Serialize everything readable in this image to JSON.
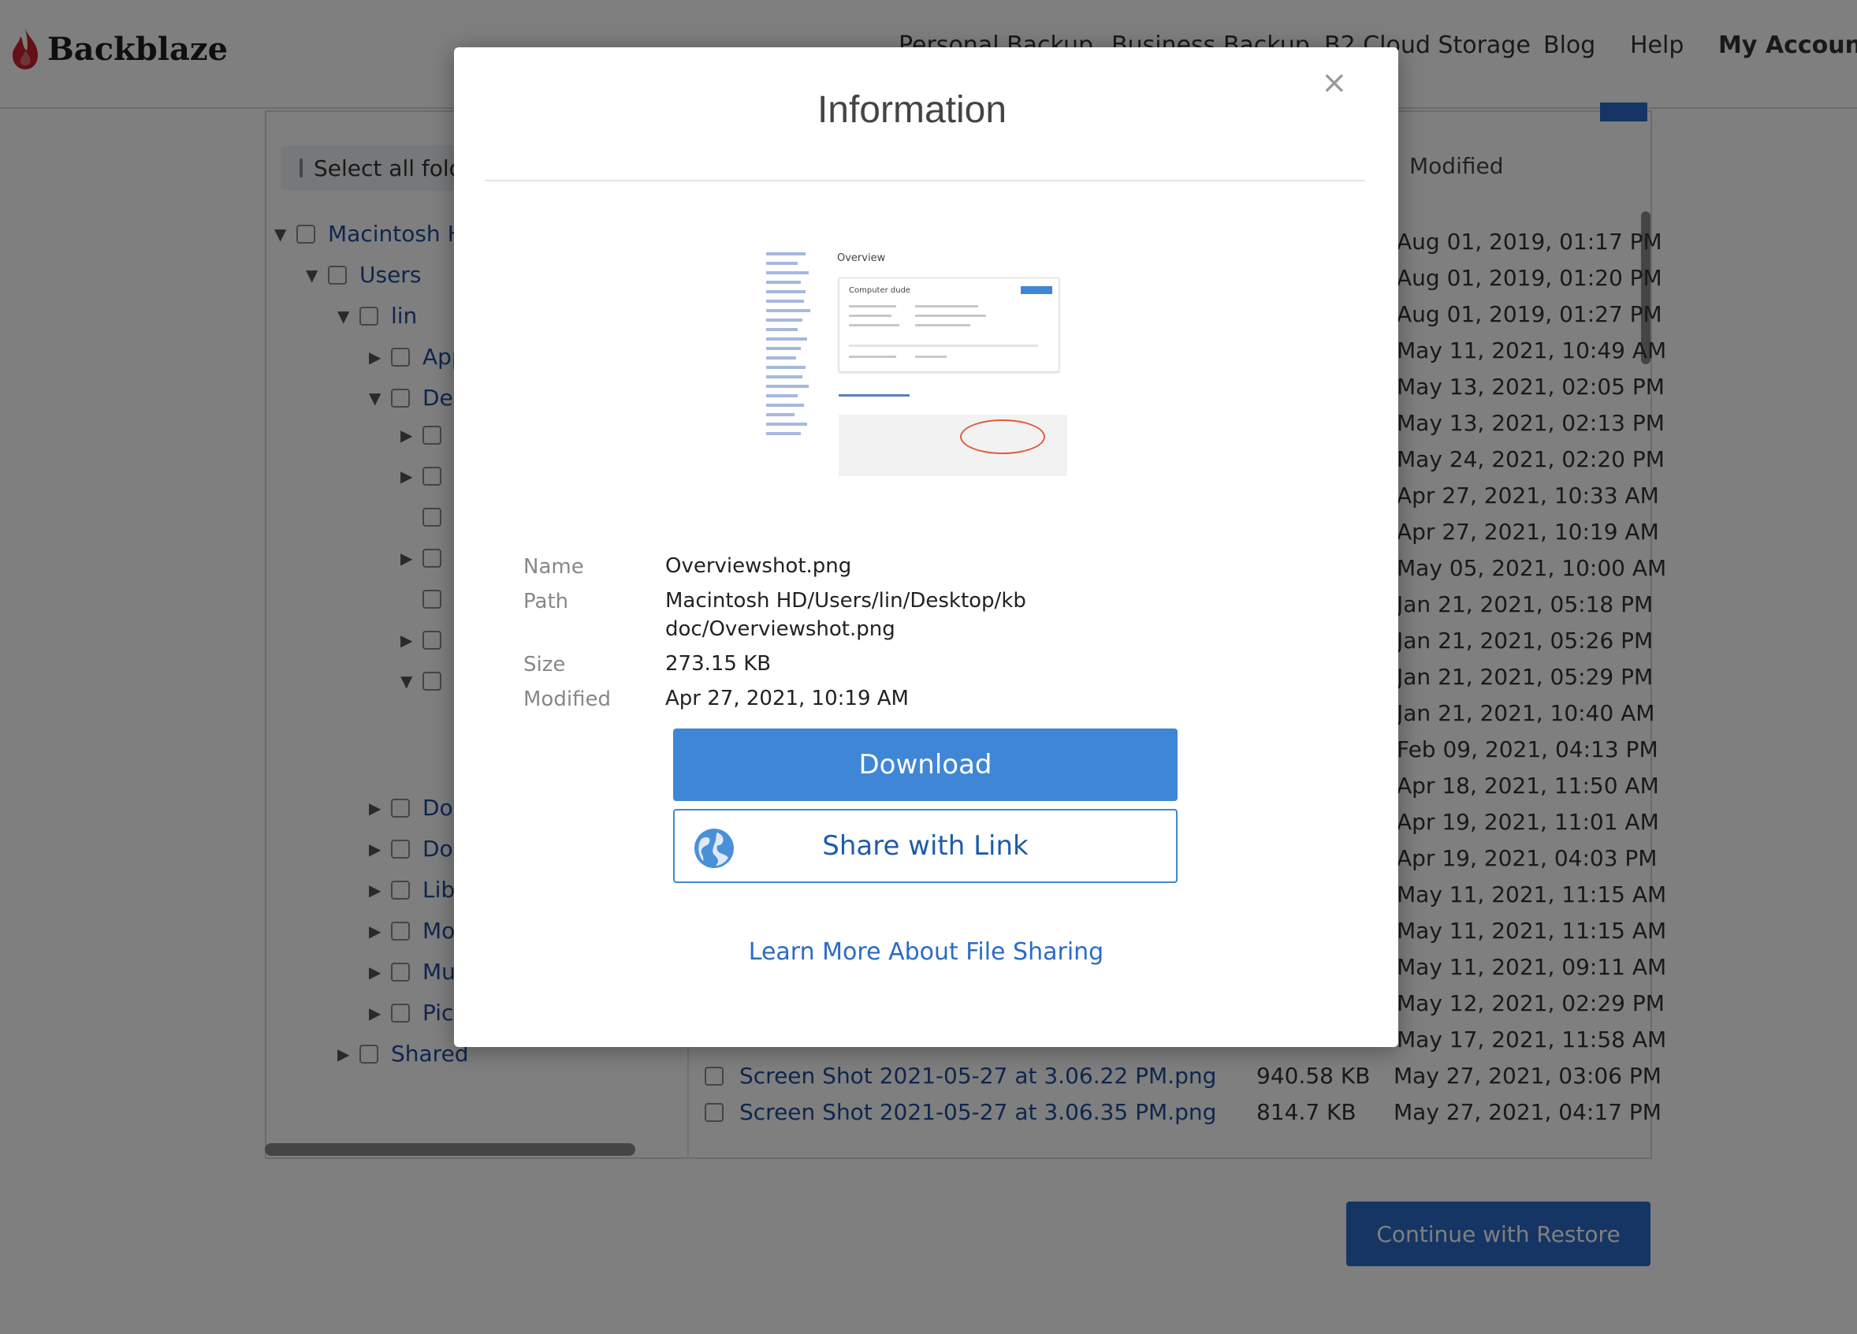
{
  "brand": {
    "name": "Backblaze"
  },
  "nav": {
    "items": [
      "Personal Backup",
      "Business Backup",
      "B2 Cloud Storage",
      "Blog",
      "Help",
      "My Account"
    ]
  },
  "browser": {
    "select_all_label": "Select all folders",
    "modified_header": "Modified",
    "tree": [
      {
        "label": "Macintosh HD",
        "expanded": true
      },
      {
        "label": "Users",
        "expanded": true
      },
      {
        "label": "lin",
        "expanded": true
      },
      {
        "label": "Applications",
        "expanded": false
      },
      {
        "label": "Desktop",
        "expanded": true
      },
      {
        "label": "Documents",
        "expanded": false
      },
      {
        "label": "Downloads",
        "expanded": false
      },
      {
        "label": "Library",
        "expanded": false
      },
      {
        "label": "Movies",
        "expanded": false
      },
      {
        "label": "Music",
        "expanded": false
      },
      {
        "label": "Pictures",
        "expanded": false
      },
      {
        "label": "Shared",
        "expanded": false
      }
    ],
    "dates": [
      "Aug 01, 2019, 01:17 PM",
      "Aug 01, 2019, 01:20 PM",
      "Aug 01, 2019, 01:27 PM",
      "May 11, 2021, 10:49 AM",
      "May 13, 2021, 02:05 PM",
      "May 13, 2021, 02:13 PM",
      "May 24, 2021, 02:20 PM",
      "Apr 27, 2021, 10:33 AM",
      "Apr 27, 2021, 10:19 AM",
      "May 05, 2021, 10:00 AM",
      "Jan 21, 2021, 05:18 PM",
      "Jan 21, 2021, 05:26 PM",
      "Jan 21, 2021, 05:29 PM",
      "Jan 21, 2021, 10:40 AM",
      "Feb 09, 2021, 04:13 PM",
      "Apr 18, 2021, 11:50 AM",
      "Apr 19, 2021, 11:01 AM",
      "Apr 19, 2021, 04:03 PM",
      "May 11, 2021, 11:15 AM",
      "May 11, 2021, 11:15 AM",
      "May 11, 2021, 09:11 AM",
      "May 12, 2021, 02:29 PM",
      "May 17, 2021, 11:58 AM"
    ],
    "files": [
      {
        "name": "Screen Shot 2021-05-27 at 3.06.22 PM.png",
        "size": "940.58 KB",
        "modified": "May 27, 2021, 03:06 PM"
      },
      {
        "name": "Screen Shot 2021-05-27 at 3.06.35 PM.png",
        "size": "814.7 KB",
        "modified": "May 27, 2021, 04:17 PM"
      }
    ],
    "continue_label": "Continue with Restore"
  },
  "modal": {
    "title": "Information",
    "close_glyph": "×",
    "preview": {
      "heading": "Overview",
      "card_title": "Computer dude"
    },
    "fields": {
      "name_label": "Name",
      "name_value": "Overviewshot.png",
      "path_label": "Path",
      "path_line1": "Macintosh HD/Users/lin/Desktop/kb",
      "path_line2": "doc/Overviewshot.png",
      "size_label": "Size",
      "size_value": "273.15 KB",
      "modified_label": "Modified",
      "modified_value": "Apr 27, 2021, 10:19 AM"
    },
    "download_label": "Download",
    "share_label": "Share with Link",
    "learn_more_label": "Learn More About File Sharing"
  },
  "colors": {
    "accent": "#3f87d6",
    "brand_red": "#c8202f",
    "link": "#2a6bc8"
  }
}
